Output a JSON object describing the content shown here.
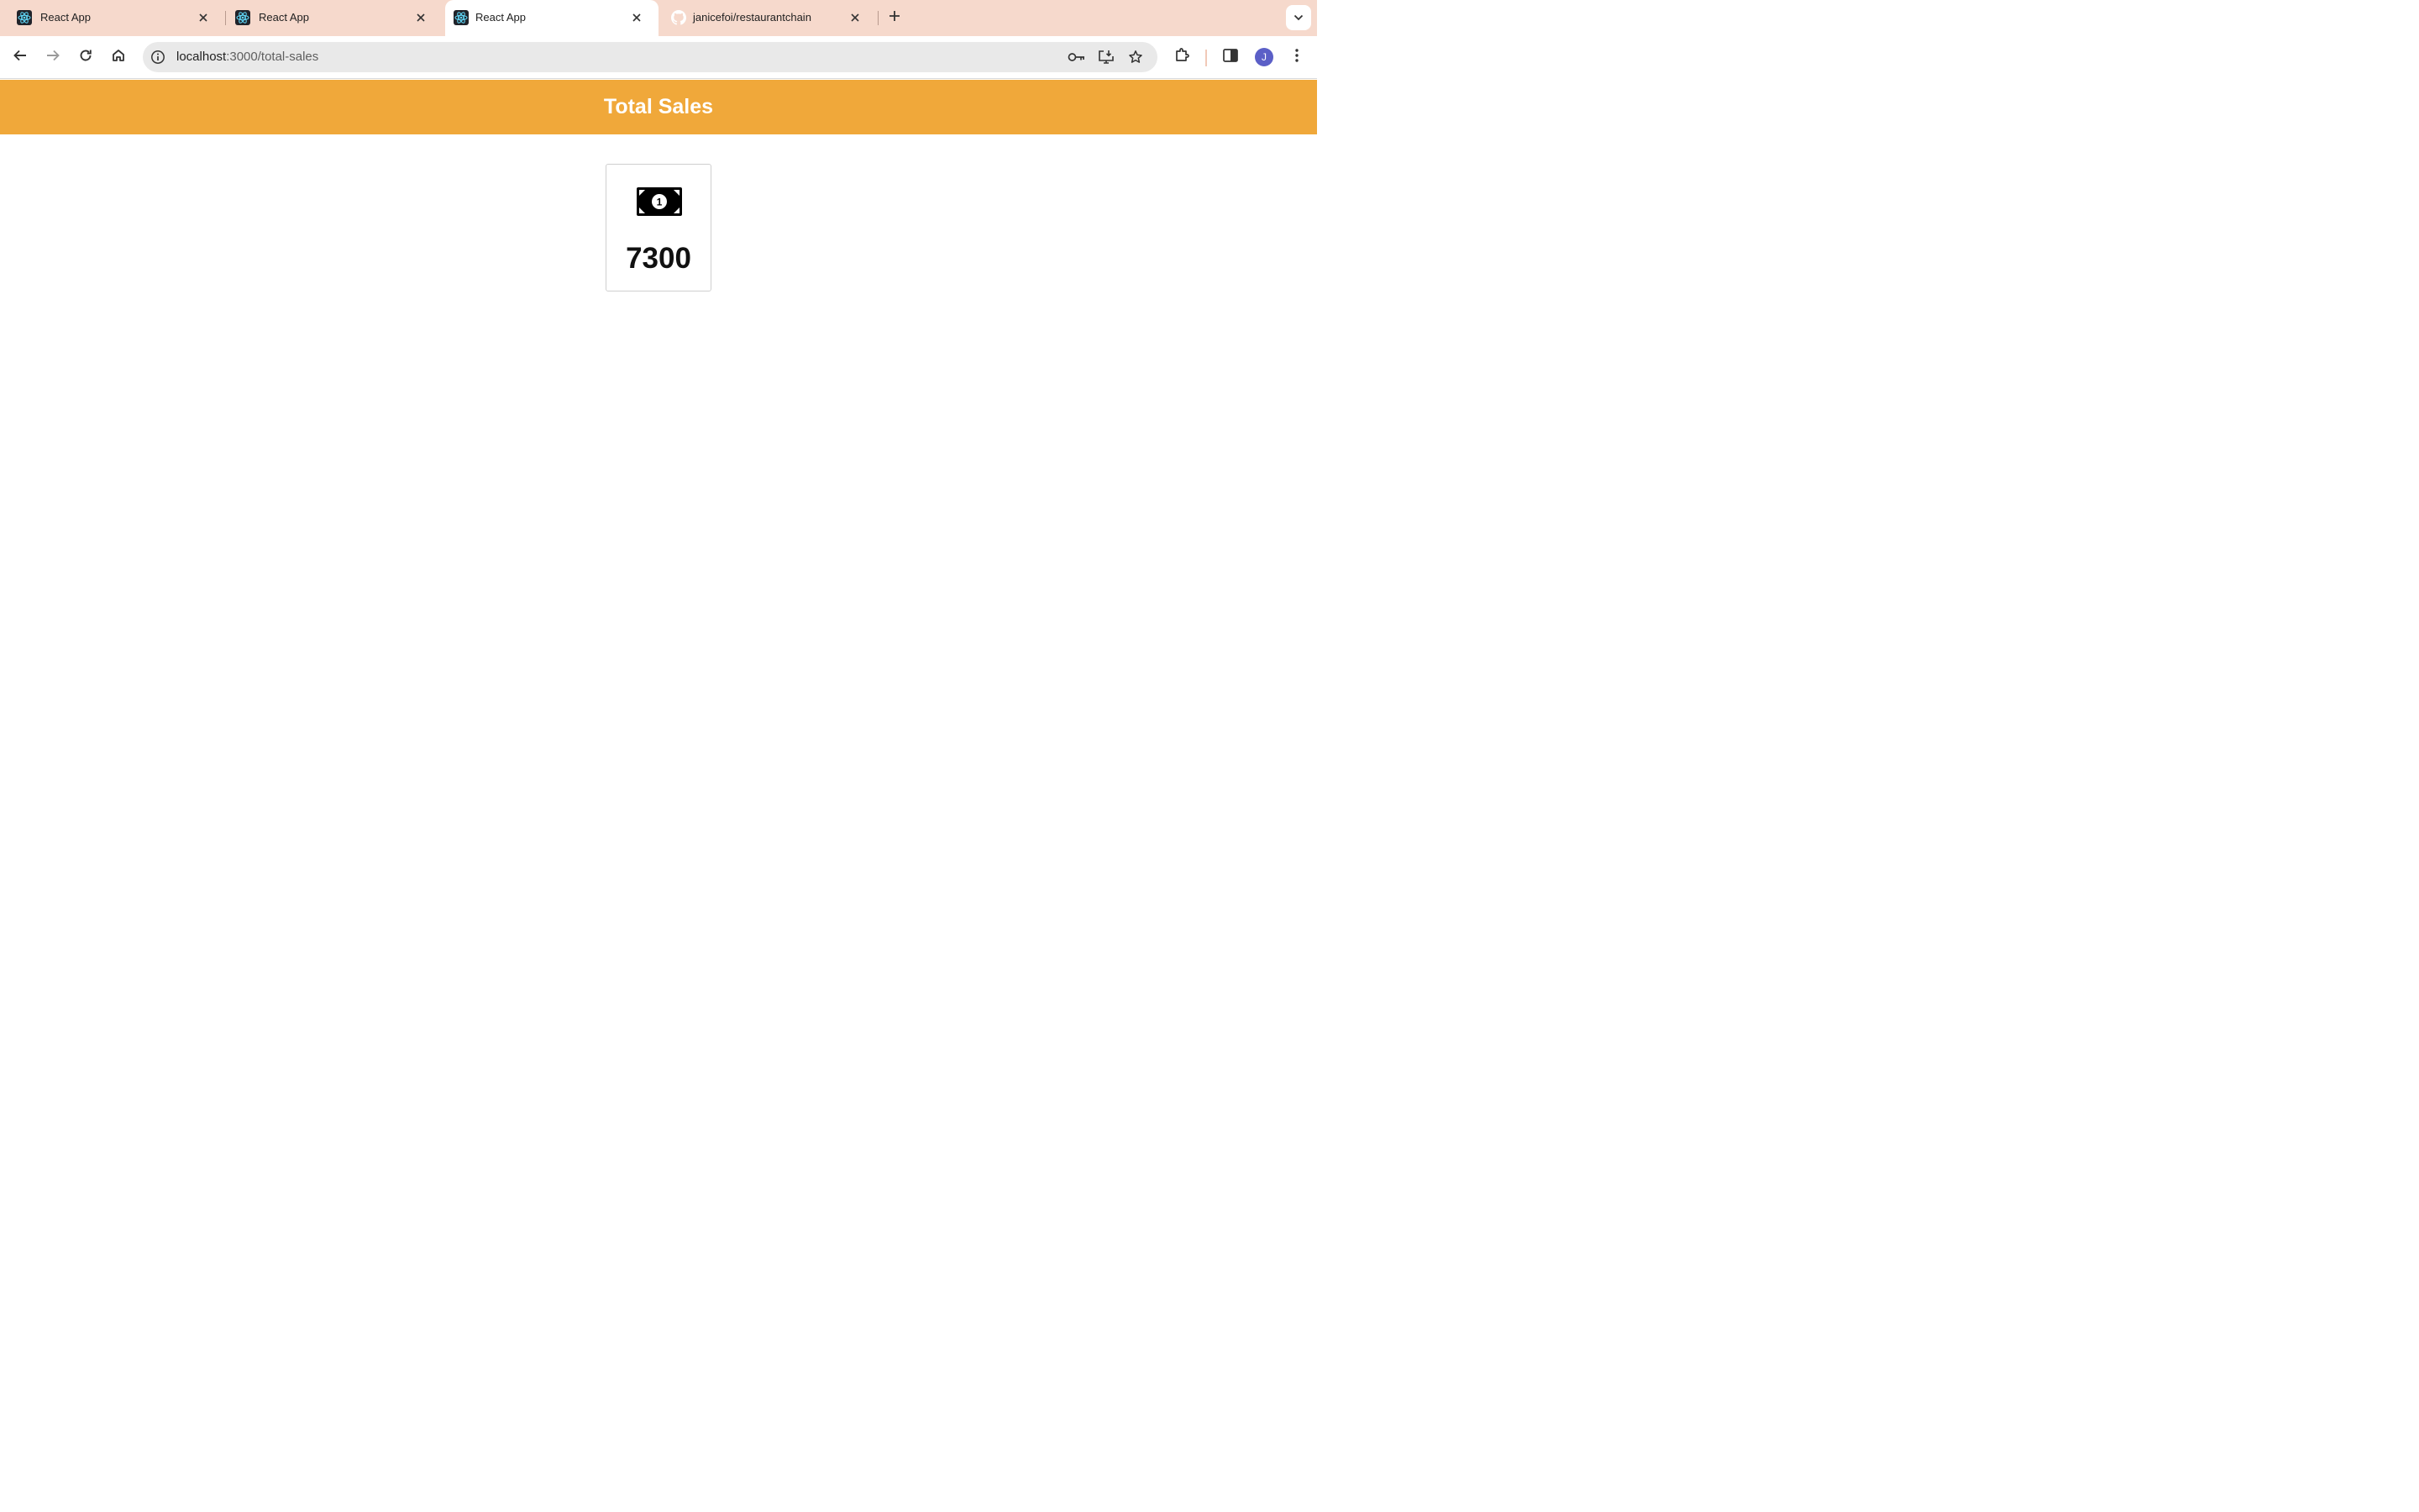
{
  "tabs": [
    {
      "title": "React App",
      "active": false,
      "favicon": "react-icon"
    },
    {
      "title": "React App",
      "active": false,
      "favicon": "react-icon"
    },
    {
      "title": "React App",
      "active": true,
      "favicon": "react-icon"
    },
    {
      "title": "janicefoi/restaurantchain",
      "active": false,
      "favicon": "github-icon"
    }
  ],
  "toolbar": {
    "url_host": "localhost",
    "url_path": ":3000/total-sales",
    "profile_initial": "J"
  },
  "page": {
    "header_title": "Total Sales",
    "card": {
      "icon": "money-bill-icon",
      "value": "7300"
    }
  },
  "colors": {
    "tabstrip": "#f6d9cc",
    "header": "#f0a83a",
    "avatar": "#5b5fc7"
  }
}
